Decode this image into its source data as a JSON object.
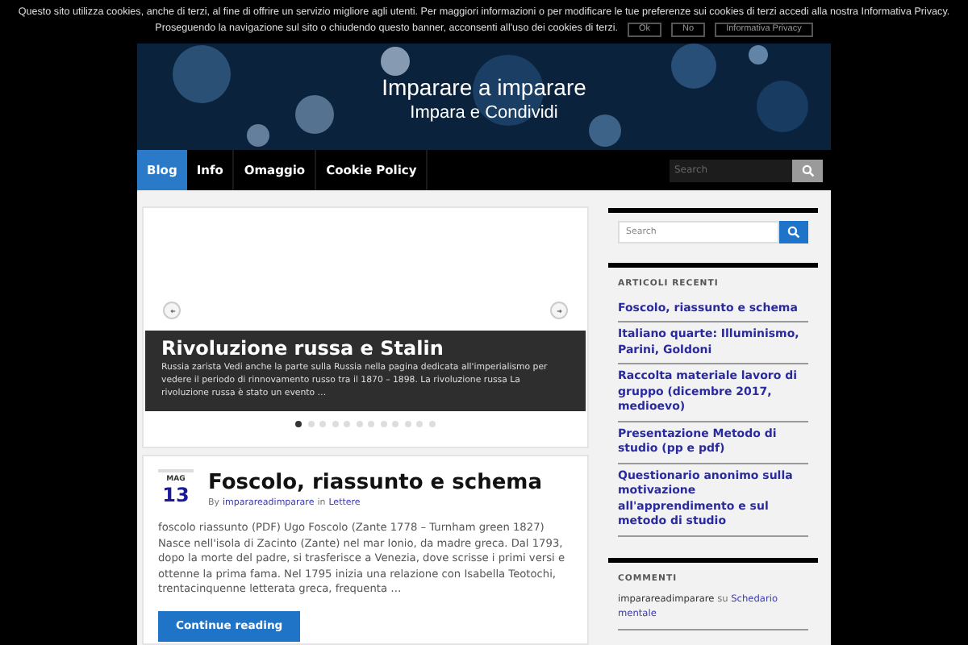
{
  "cookie_banner": {
    "lines": [
      "Questo sito utilizza cookies, anche di terzi, al fine di offrire un servizio migliore agli utenti. Per maggiori informazioni o per modificare le tue preferenze sui cookies di terzi accedi alla nostra Informativa Privacy.",
      "Proseguendo la navigazione sul sito o chiudendo questo banner, acconsenti all'uso dei cookies di terzi."
    ],
    "buttons": [
      "Ok",
      "No",
      "Informativa Privacy"
    ]
  },
  "header": {
    "title": "Imparare a imparare",
    "tagline": "Impara e Condividi"
  },
  "nav": {
    "items": [
      {
        "label": "Blog",
        "selected": true
      },
      {
        "label": "Info",
        "selected": false
      },
      {
        "label": "Omaggio",
        "selected": false
      },
      {
        "label": "Cookie Policy",
        "selected": false
      }
    ],
    "search": {
      "placeholder": "Search"
    }
  },
  "slider": {
    "caption_title": "Rivoluzione russa e Stalin",
    "caption_text": "Russia zarista Vedi anche la parte sulla Russia nella pagina dedicata all'imperialismo per vedere il periodo di rinnovamento russo tra il 1870 – 1898.   La rivoluzione russa La rivoluzione russa è stato un evento …",
    "dots": [
      {
        "selected": true
      },
      {
        "selected": false
      },
      {
        "selected": false
      },
      {
        "selected": false
      },
      {
        "selected": false
      },
      {
        "selected": false
      },
      {
        "selected": false
      },
      {
        "selected": false
      },
      {
        "selected": false
      },
      {
        "selected": false
      },
      {
        "selected": false
      },
      {
        "selected": false
      }
    ]
  },
  "post": {
    "month": "MAG",
    "day": "13",
    "title": "Foscolo, riassunto e schema",
    "by": "By",
    "author": "imparareadimparare",
    "in": "in",
    "category": "Lettere",
    "excerpt": "foscolo riassunto (PDF) Ugo Foscolo (Zante 1778 – Turnham green 1827) Nasce nell'isola di Zacinto (Zante) nel mar Ionio, da madre greca. Dal 1793, dopo la morte del padre, si trasferisce a Venezia, dove scrisse i primi versi e ottenne la prima fama. Nel 1795 inizia una relazione con Isabella Teotochi, trentacinquenne letterata greca, frequenta …",
    "button": "Continue reading"
  },
  "sidebar": {
    "search": {
      "placeholder": "Search"
    },
    "recent_title": "ARTICOLI RECENTI",
    "recent": [
      "Foscolo, riassunto e schema",
      "Italiano quarte: Illuminismo, Parini, Goldoni",
      "Raccolta materiale lavoro di gruppo (dicembre 2017, medioevo)",
      "Presentazione Metodo di studio (pp e pdf)",
      "Questionario anonimo sulla motivazione all'apprendimento e sul metodo di studio"
    ],
    "comments_title": "COMMENTI",
    "comments": [
      {
        "author": "imparareadimparare",
        "su": "su",
        "post": "Schedario mentale"
      }
    ]
  }
}
